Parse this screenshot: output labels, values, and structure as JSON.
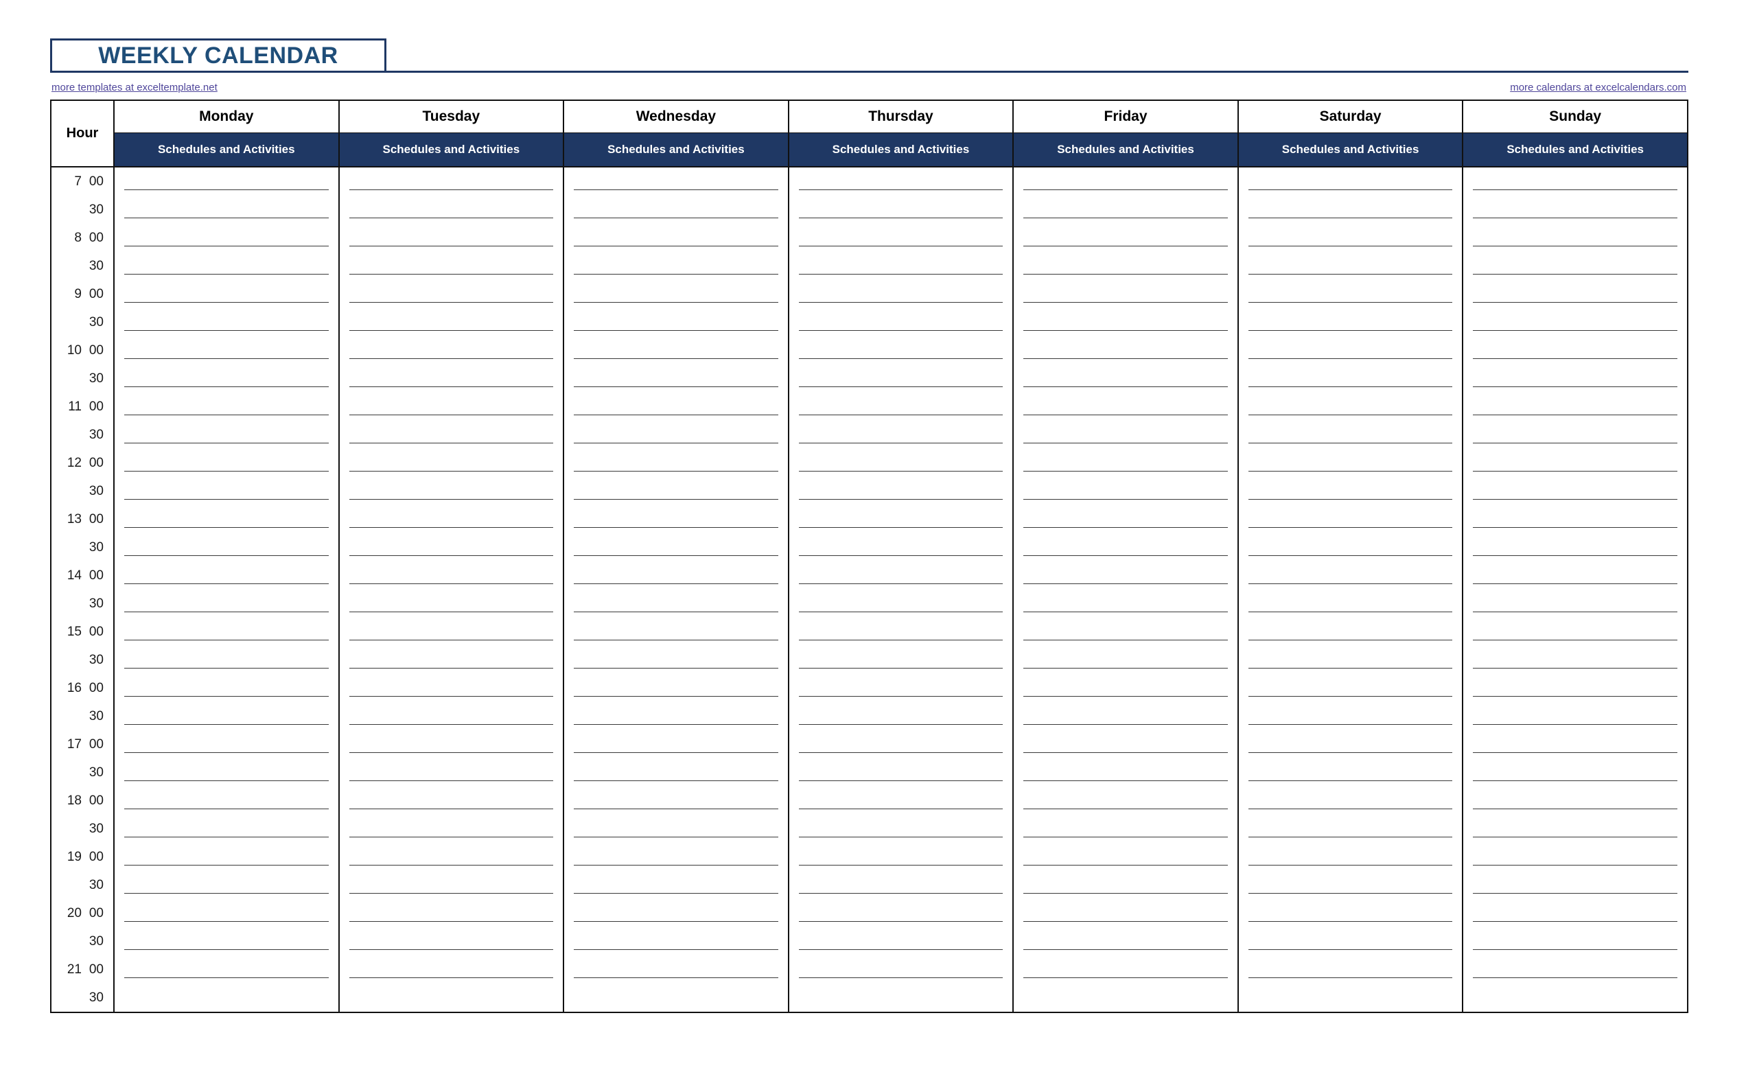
{
  "page": {
    "title": "WEEKLY CALENDAR",
    "accent_color": "#1F3864",
    "title_color": "#1F4E79",
    "link_color": "#50479B"
  },
  "links": {
    "left": "more templates at exceltemplate.net",
    "right": "more calendars at excelcalendars.com"
  },
  "table": {
    "hour_header": "Hour",
    "sub_header": "Schedules and Activities",
    "days": [
      "Monday",
      "Tuesday",
      "Wednesday",
      "Thursday",
      "Friday",
      "Saturday",
      "Sunday"
    ],
    "rows": [
      {
        "hour": "7",
        "minute": "00"
      },
      {
        "hour": "",
        "minute": "30"
      },
      {
        "hour": "8",
        "minute": "00"
      },
      {
        "hour": "",
        "minute": "30"
      },
      {
        "hour": "9",
        "minute": "00"
      },
      {
        "hour": "",
        "minute": "30"
      },
      {
        "hour": "10",
        "minute": "00"
      },
      {
        "hour": "",
        "minute": "30"
      },
      {
        "hour": "11",
        "minute": "00"
      },
      {
        "hour": "",
        "minute": "30"
      },
      {
        "hour": "12",
        "minute": "00"
      },
      {
        "hour": "",
        "minute": "30"
      },
      {
        "hour": "13",
        "minute": "00"
      },
      {
        "hour": "",
        "minute": "30"
      },
      {
        "hour": "14",
        "minute": "00"
      },
      {
        "hour": "",
        "minute": "30"
      },
      {
        "hour": "15",
        "minute": "00"
      },
      {
        "hour": "",
        "minute": "30"
      },
      {
        "hour": "16",
        "minute": "00"
      },
      {
        "hour": "",
        "minute": "30"
      },
      {
        "hour": "17",
        "minute": "00"
      },
      {
        "hour": "",
        "minute": "30"
      },
      {
        "hour": "18",
        "minute": "00"
      },
      {
        "hour": "",
        "minute": "30"
      },
      {
        "hour": "19",
        "minute": "00"
      },
      {
        "hour": "",
        "minute": "30"
      },
      {
        "hour": "20",
        "minute": "00"
      },
      {
        "hour": "",
        "minute": "30"
      },
      {
        "hour": "21",
        "minute": "00"
      },
      {
        "hour": "",
        "minute": "30"
      }
    ],
    "cells": [
      [
        "",
        "",
        "",
        "",
        "",
        "",
        ""
      ],
      [
        "",
        "",
        "",
        "",
        "",
        "",
        ""
      ],
      [
        "",
        "",
        "",
        "",
        "",
        "",
        ""
      ],
      [
        "",
        "",
        "",
        "",
        "",
        "",
        ""
      ],
      [
        "",
        "",
        "",
        "",
        "",
        "",
        ""
      ],
      [
        "",
        "",
        "",
        "",
        "",
        "",
        ""
      ],
      [
        "",
        "",
        "",
        "",
        "",
        "",
        ""
      ],
      [
        "",
        "",
        "",
        "",
        "",
        "",
        ""
      ],
      [
        "",
        "",
        "",
        "",
        "",
        "",
        ""
      ],
      [
        "",
        "",
        "",
        "",
        "",
        "",
        ""
      ],
      [
        "",
        "",
        "",
        "",
        "",
        "",
        ""
      ],
      [
        "",
        "",
        "",
        "",
        "",
        "",
        ""
      ],
      [
        "",
        "",
        "",
        "",
        "",
        "",
        ""
      ],
      [
        "",
        "",
        "",
        "",
        "",
        "",
        ""
      ],
      [
        "",
        "",
        "",
        "",
        "",
        "",
        ""
      ],
      [
        "",
        "",
        "",
        "",
        "",
        "",
        ""
      ],
      [
        "",
        "",
        "",
        "",
        "",
        "",
        ""
      ],
      [
        "",
        "",
        "",
        "",
        "",
        "",
        ""
      ],
      [
        "",
        "",
        "",
        "",
        "",
        "",
        ""
      ],
      [
        "",
        "",
        "",
        "",
        "",
        "",
        ""
      ],
      [
        "",
        "",
        "",
        "",
        "",
        "",
        ""
      ],
      [
        "",
        "",
        "",
        "",
        "",
        "",
        ""
      ],
      [
        "",
        "",
        "",
        "",
        "",
        "",
        ""
      ],
      [
        "",
        "",
        "",
        "",
        "",
        "",
        ""
      ],
      [
        "",
        "",
        "",
        "",
        "",
        "",
        ""
      ],
      [
        "",
        "",
        "",
        "",
        "",
        "",
        ""
      ],
      [
        "",
        "",
        "",
        "",
        "",
        "",
        ""
      ],
      [
        "",
        "",
        "",
        "",
        "",
        "",
        ""
      ],
      [
        "",
        "",
        "",
        "",
        "",
        "",
        ""
      ],
      [
        "",
        "",
        "",
        "",
        "",
        "",
        ""
      ]
    ]
  }
}
